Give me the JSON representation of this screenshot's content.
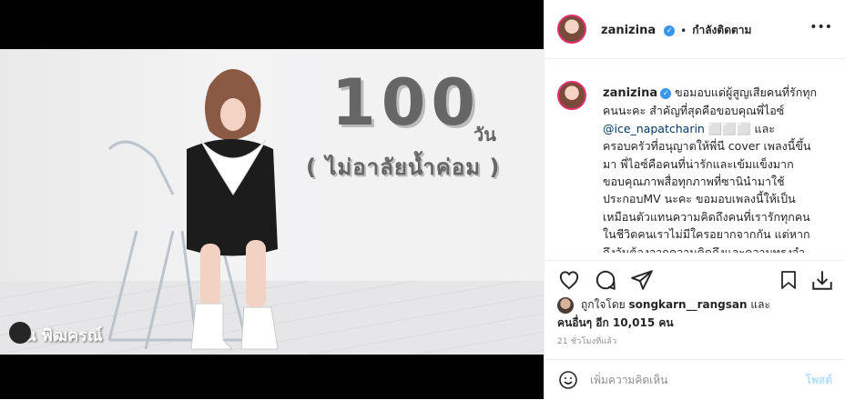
{
  "post": {
    "image": {
      "title_number": "100",
      "title_suffix": "วัน",
      "subtitle": "( ไม่อาลัยน้ำค่อม )",
      "watermark": "ปัน พิฒครณ์"
    },
    "header": {
      "username": "zanizina",
      "separator": "•",
      "follow_label": "กำลังติดตาม",
      "more_icon": "more-horizontal-icon"
    },
    "caption": {
      "username": "zanizina",
      "text_1": "ขอมอบแด่ผู้สูญเสียคนที่รักทุกคนนะคะ สำคัญที่สุดคือขอบคุณพี่ไอซ์",
      "mention": "@ice_napatcharin",
      "text_2": "⬜⬜⬜ และครอบครัวที่อนุญาตให้พี่นี cover เพลงนี้ขึ้นมา พี่ไอซ์คือคนที่น่ารักและเข้มแข็งมาก ขอบคุณภาพสื่อทุกภาพที่ซานินำมาใช้ประกอบMV นะคะ ขอมอบเพลงนี้ให้เป็นเหมือนตัวแทนความคิดถึงคนที่เรารักทุกคน ในชีวิตคนเราไม่มีใครอยากจากกัน แต่หากถึงวันต้องจากความคิดถึงและความทรงจำส่วนนี้ที่ไม่เคย"
    },
    "actions": {
      "like_icon": "heart-icon",
      "comment_icon": "comment-icon",
      "share_icon": "share-icon",
      "save_icon": "bookmark-icon",
      "download_icon": "download-icon"
    },
    "likes": {
      "prefix": "ถูกใจโดย",
      "liker": "songkarn__rangsan",
      "conj": "และ",
      "others": "คนอื่นๆ อีก 10,015 คน"
    },
    "time_ago": "21 ชั่วโมงที่แล้ว",
    "comment": {
      "placeholder": "เพิ่มความคิดเห็น",
      "post_label": "โพสต์",
      "emoji_icon": "emoji-icon"
    }
  },
  "colors": {
    "accent": "#3897f0",
    "link": "#00376b",
    "text": "#262626",
    "muted": "#8e8e8e",
    "border": "#efefef"
  }
}
